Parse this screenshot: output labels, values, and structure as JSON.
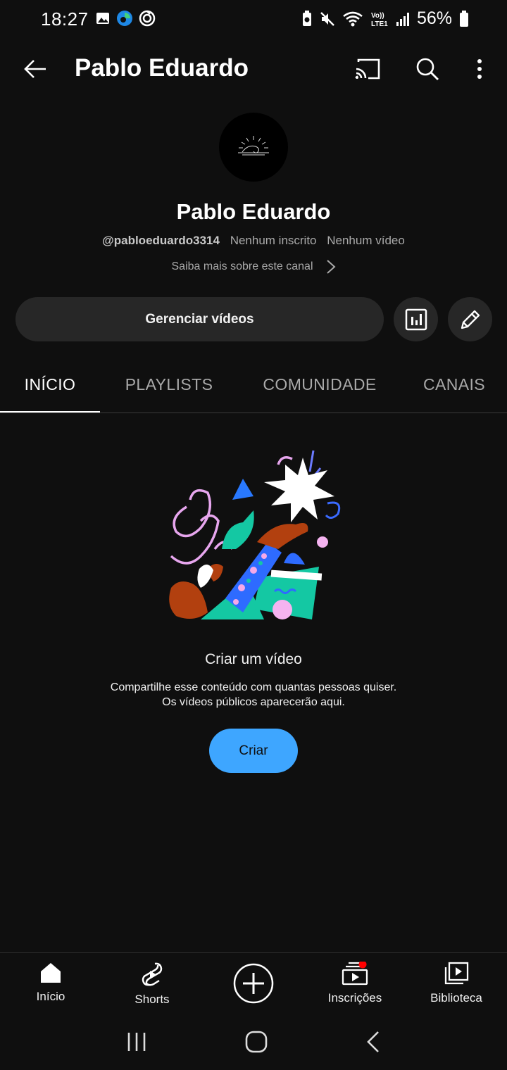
{
  "status_bar": {
    "time": "18:27",
    "battery": "56%",
    "icons": [
      "gallery-icon",
      "edge-icon",
      "sync-icon",
      "battery-saver-icon",
      "mute-icon",
      "wifi-icon",
      "volte-icon",
      "signal-icon",
      "battery-icon"
    ]
  },
  "app_bar": {
    "title": "Pablo Eduardo",
    "icons": [
      "back-arrow-icon",
      "cast-icon",
      "search-icon",
      "more-vert-icon"
    ]
  },
  "channel": {
    "name": "Pablo Eduardo",
    "handle": "@pabloeduardo3314",
    "subscribers": "Nenhum inscrito",
    "videos": "Nenhum vídeo",
    "about_link": "Saiba mais sobre este canal"
  },
  "actions": {
    "manage_label": "Gerenciar vídeos",
    "icons": [
      "analytics-icon",
      "edit-pencil-icon"
    ]
  },
  "tabs": [
    {
      "label": "INÍCIO",
      "active": true
    },
    {
      "label": "PLAYLISTS",
      "active": false
    },
    {
      "label": "COMUNIDADE",
      "active": false
    },
    {
      "label": "CANAIS",
      "active": false
    }
  ],
  "empty_state": {
    "title": "Criar um vídeo",
    "description_line1": "Compartilhe esse conteúdo com quantas pessoas quiser.",
    "description_line2": "Os vídeos públicos aparecerão aqui.",
    "button_label": "Criar"
  },
  "bottom_nav": [
    {
      "label": "Início",
      "icon": "home-icon"
    },
    {
      "label": "Shorts",
      "icon": "shorts-icon"
    },
    {
      "label": "",
      "icon": "create-plus-icon"
    },
    {
      "label": "Inscrições",
      "icon": "subscriptions-icon",
      "badge": true
    },
    {
      "label": "Biblioteca",
      "icon": "library-icon"
    }
  ],
  "system_nav": [
    "recents-icon",
    "home-button-icon",
    "back-icon"
  ],
  "colors": {
    "background": "#0f0f0f",
    "surface": "#272727",
    "accent_blue": "#3ea6ff",
    "badge_red": "#ff0000",
    "text_secondary": "#aaaaaa"
  }
}
